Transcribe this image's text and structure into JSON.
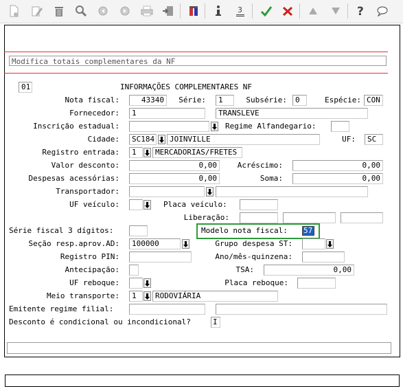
{
  "title": "Modifica totais complementares da NF",
  "page_code": "01",
  "section_title": "INFORMAÇÕES COMPLEMENTARES NF",
  "labels": {
    "nota_fiscal": "Nota fiscal:",
    "serie": "Série:",
    "subserie": "Subsérie:",
    "especie": "Espécie:",
    "fornecedor": "Fornecedor:",
    "inscricao": "Inscrição estadual:",
    "regime_alf": "Regime Alfandegario:",
    "cidade": "Cidade:",
    "uf": "UF:",
    "registro_entrada": "Registro entrada:",
    "valor_desconto": "Valor desconto:",
    "acrescimo": "Acréscimo:",
    "despesas": "Despesas acessórias:",
    "soma": "Soma:",
    "transportador": "Transportador:",
    "uf_veiculo": "UF veículo:",
    "placa_veiculo": "Placa veículo:",
    "liberacao": "Liberação:",
    "serie_fiscal": "Série fiscal 3 dígitos:",
    "modelo_nf": "Modelo nota fiscal:",
    "secao": "Seção resp.aprov.AD:",
    "grupo_despesa": "Grupo despesa ST:",
    "registro_pin": "Registro PIN:",
    "ano_mes": "Ano/mês-quinzena:",
    "antecipacao": "Antecipação:",
    "tsa": "TSA:",
    "uf_reboque": "UF reboque:",
    "placa_reboque": "Placa reboque:",
    "meio_transporte": "Meio transporte:",
    "emitente": "Emitente regime filial:",
    "desconto_cond": "Desconto é condicional ou incondicional?"
  },
  "values": {
    "nota_fiscal": "43340",
    "serie": "1",
    "subserie": "0",
    "especie": "CON",
    "fornecedor_code": "1",
    "fornecedor_name": "TRANSLEVE",
    "cidade_code": "SC184",
    "cidade_name": "JOINVILLE",
    "uf": "SC",
    "registro_entrada_code": "1",
    "registro_entrada_name": "MERCADORIAS/FRETES",
    "valor_desconto": "0,00",
    "acrescimo": "0,00",
    "despesas": "0,00",
    "soma": "0,00",
    "modelo_nf": "57",
    "secao": "100000",
    "tsa": "0,00",
    "meio_transporte_code": "1",
    "meio_transporte_name": "RODOVIÁRIA",
    "desconto_cond": "I"
  },
  "toolbar": {
    "tooltips": [
      "new",
      "edit",
      "delete",
      "search",
      "first",
      "last",
      "print",
      "exit",
      "colors",
      "info",
      "footnote",
      "confirm",
      "cancel",
      "up",
      "down",
      "help",
      "comment"
    ],
    "colors": {
      "confirm": "#2e9a3a",
      "cancel": "#cc2222",
      "accent": "#2e9a3a",
      "selection": "#1e5fbf"
    }
  }
}
